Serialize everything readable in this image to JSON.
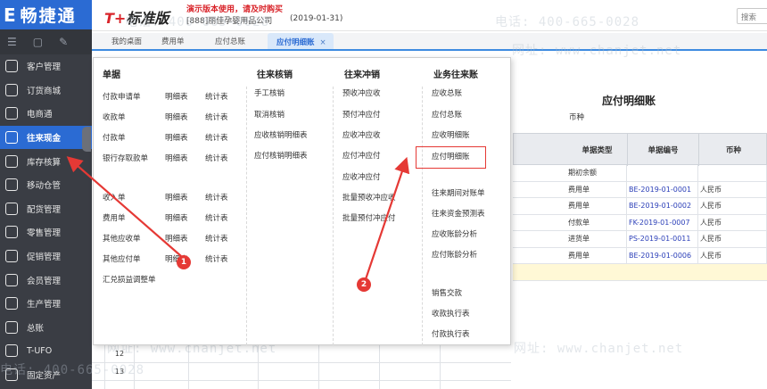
{
  "app": {
    "logo_text": "畅捷通",
    "logo_glyph": "E",
    "brand_prefix": "T+",
    "brand_text": "标准版",
    "demo_warning": "演示版本使用，请及时购买",
    "company": "[888]丽佳孕婴用品公司",
    "date": "(2019-01-31)",
    "search_placeholder": "搜索"
  },
  "sidebar": {
    "items": [
      {
        "label": "客户管理",
        "icon": "customer-icon"
      },
      {
        "label": "订货商城",
        "icon": "store-icon"
      },
      {
        "label": "电商通",
        "icon": "ecommerce-icon"
      },
      {
        "label": "往来现金",
        "icon": "exchange-icon",
        "active": true
      },
      {
        "label": "库存核算",
        "icon": "warehouse-icon"
      },
      {
        "label": "移动仓管",
        "icon": "mobile-warehouse-icon"
      },
      {
        "label": "配货管理",
        "icon": "distribution-icon"
      },
      {
        "label": "零售管理",
        "icon": "retail-icon"
      },
      {
        "label": "促销管理",
        "icon": "promotion-icon"
      },
      {
        "label": "会员管理",
        "icon": "member-icon"
      },
      {
        "label": "生产管理",
        "icon": "production-icon"
      },
      {
        "label": "总账",
        "icon": "ledger-icon"
      },
      {
        "label": "T-UFO",
        "icon": "ufo-icon"
      },
      {
        "label": "固定资产",
        "icon": "asset-icon"
      }
    ]
  },
  "tabs": [
    {
      "label": "我的桌面"
    },
    {
      "label": "费用单"
    },
    {
      "label": "应付总账"
    },
    {
      "label": "应付明细账",
      "active": true,
      "close": "×"
    }
  ],
  "menu": {
    "col1": {
      "header": "单据",
      "rows": [
        [
          "付款申请单",
          "明细表",
          "统计表"
        ],
        [
          "收款单",
          "明细表",
          "统计表"
        ],
        [
          "付款单",
          "明细表",
          "统计表"
        ],
        [
          "银行存取款单",
          "明细表",
          "统计表"
        ],
        [
          "收入单",
          "明细表",
          "统计表"
        ],
        [
          "费用单",
          "明细表",
          "统计表"
        ],
        [
          "其他应收单",
          "明细表",
          "统计表"
        ],
        [
          "其他应付单",
          "明细表",
          "统计表"
        ],
        [
          "汇兑损益调整单",
          "",
          ""
        ]
      ]
    },
    "col2": {
      "header": "往来核销",
      "items": [
        "手工核销",
        "取消核销",
        "应收核销明细表",
        "应付核销明细表"
      ]
    },
    "col3": {
      "header": "往来冲销",
      "items": [
        "预收冲应收",
        "预付冲应付",
        "应收冲应收",
        "应付冲应付",
        "应收冲应付",
        "批量预收冲应收",
        "批量预付冲应付"
      ]
    },
    "col4": {
      "header": "业务往来账",
      "items": [
        "应收总账",
        "应付总账",
        "应收明细账",
        "应付明细账",
        "往来期间对账单",
        "往来资金预测表",
        "应收账龄分析",
        "应付账龄分析",
        "销售交款",
        "收款执行表",
        "付款执行表"
      ]
    }
  },
  "report": {
    "title": "应付明细账",
    "currency_label": "币种",
    "columns": [
      "单据类型",
      "单据编号",
      "币种"
    ],
    "rows": [
      [
        "期初余额",
        "",
        ""
      ],
      [
        "费用单",
        "BE-2019-01-0001",
        "人民币"
      ],
      [
        "费用单",
        "BE-2019-01-0002",
        "人民币"
      ],
      [
        "付款单",
        "FK-2019-01-0007",
        "人民币"
      ],
      [
        "进货单",
        "PS-2019-01-0011",
        "人民币"
      ],
      [
        "费用单",
        "BE-2019-01-0006",
        "人民币"
      ]
    ],
    "row_numbers": [
      "12",
      "13",
      ""
    ]
  },
  "watermarks": [
    {
      "text": "电话: 400-665-0028"
    },
    {
      "text": "网址: www.chanjet.net"
    }
  ],
  "annotations": {
    "badge1": "1",
    "badge2": "2"
  },
  "colors": {
    "sidebar_bg": "#3a3d44",
    "accent": "#2b6bd3",
    "annotation": "#e53935"
  }
}
